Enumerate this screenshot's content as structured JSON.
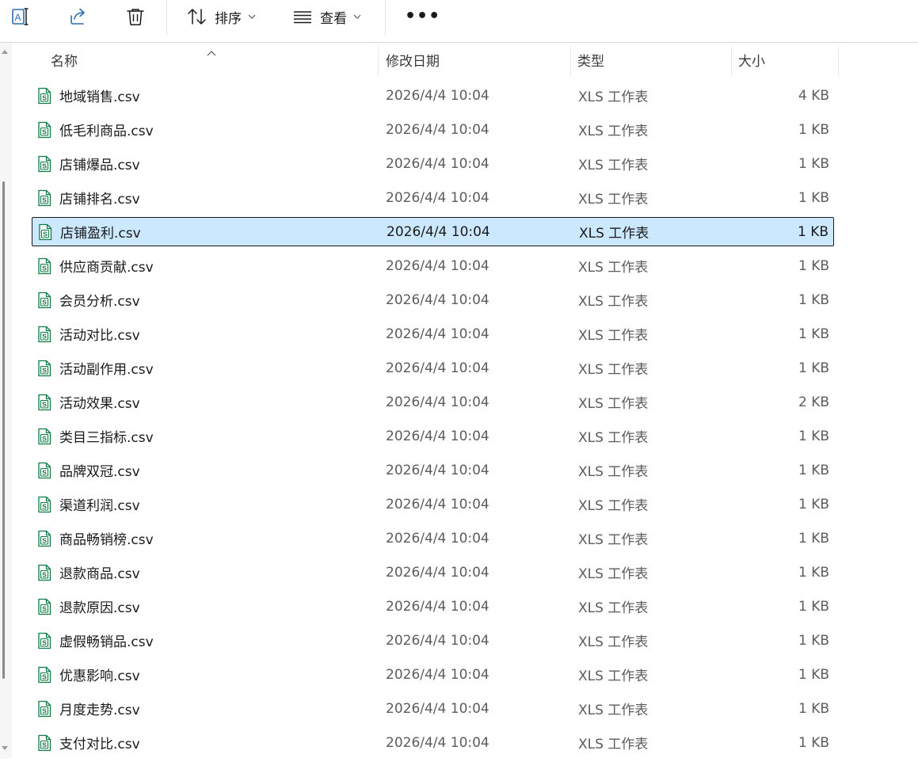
{
  "toolbar": {
    "rename_icon": "rename-icon",
    "share_icon": "share-icon",
    "delete_icon": "trash-icon",
    "sort_label": "排序",
    "view_label": "查看",
    "more_label": "•••"
  },
  "columns": {
    "name": "名称",
    "modified": "修改日期",
    "type": "类型",
    "size": "大小"
  },
  "colors": {
    "accent": "#0f7b45",
    "selection_bg": "#cce8ff",
    "selection_border": "#1a1a1a",
    "muted_text": "#5c5c5c"
  },
  "files": [
    {
      "name": "地域销售.csv",
      "modified": "2026/4/4 10:04",
      "type": "XLS 工作表",
      "size": "4 KB"
    },
    {
      "name": "低毛利商品.csv",
      "modified": "2026/4/4 10:04",
      "type": "XLS 工作表",
      "size": "1 KB"
    },
    {
      "name": "店铺爆品.csv",
      "modified": "2026/4/4 10:04",
      "type": "XLS 工作表",
      "size": "1 KB"
    },
    {
      "name": "店铺排名.csv",
      "modified": "2026/4/4 10:04",
      "type": "XLS 工作表",
      "size": "1 KB"
    },
    {
      "name": "店铺盈利.csv",
      "modified": "2026/4/4 10:04",
      "type": "XLS 工作表",
      "size": "1 KB",
      "selected": true
    },
    {
      "name": "供应商贡献.csv",
      "modified": "2026/4/4 10:04",
      "type": "XLS 工作表",
      "size": "1 KB"
    },
    {
      "name": "会员分析.csv",
      "modified": "2026/4/4 10:04",
      "type": "XLS 工作表",
      "size": "1 KB"
    },
    {
      "name": "活动对比.csv",
      "modified": "2026/4/4 10:04",
      "type": "XLS 工作表",
      "size": "1 KB"
    },
    {
      "name": "活动副作用.csv",
      "modified": "2026/4/4 10:04",
      "type": "XLS 工作表",
      "size": "1 KB"
    },
    {
      "name": "活动效果.csv",
      "modified": "2026/4/4 10:04",
      "type": "XLS 工作表",
      "size": "2 KB"
    },
    {
      "name": "类目三指标.csv",
      "modified": "2026/4/4 10:04",
      "type": "XLS 工作表",
      "size": "1 KB"
    },
    {
      "name": "品牌双冠.csv",
      "modified": "2026/4/4 10:04",
      "type": "XLS 工作表",
      "size": "1 KB"
    },
    {
      "name": "渠道利润.csv",
      "modified": "2026/4/4 10:04",
      "type": "XLS 工作表",
      "size": "1 KB"
    },
    {
      "name": "商品畅销榜.csv",
      "modified": "2026/4/4 10:04",
      "type": "XLS 工作表",
      "size": "1 KB"
    },
    {
      "name": "退款商品.csv",
      "modified": "2026/4/4 10:04",
      "type": "XLS 工作表",
      "size": "1 KB"
    },
    {
      "name": "退款原因.csv",
      "modified": "2026/4/4 10:04",
      "type": "XLS 工作表",
      "size": "1 KB"
    },
    {
      "name": "虚假畅销品.csv",
      "modified": "2026/4/4 10:04",
      "type": "XLS 工作表",
      "size": "1 KB"
    },
    {
      "name": "优惠影响.csv",
      "modified": "2026/4/4 10:04",
      "type": "XLS 工作表",
      "size": "1 KB"
    },
    {
      "name": "月度走势.csv",
      "modified": "2026/4/4 10:04",
      "type": "XLS 工作表",
      "size": "1 KB"
    },
    {
      "name": "支付对比.csv",
      "modified": "2026/4/4 10:04",
      "type": "XLS 工作表",
      "size": "1 KB"
    }
  ]
}
